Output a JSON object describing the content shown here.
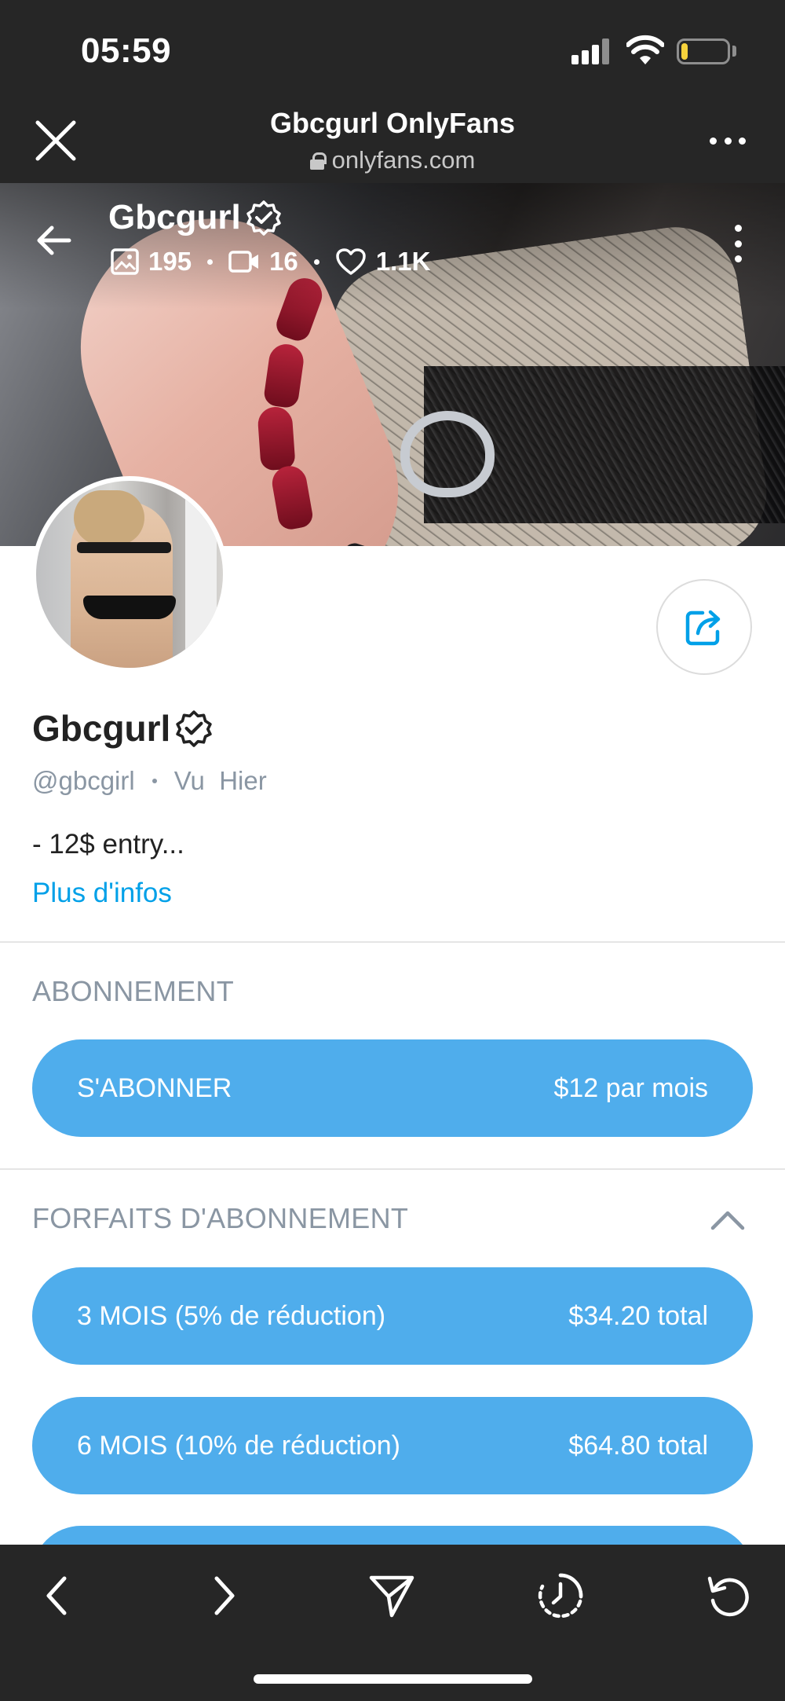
{
  "status_bar": {
    "time": "05:59",
    "battery_level": 0.15,
    "battery_color": "#f7d33c"
  },
  "browser": {
    "title": "Gbcgurl OnlyFans",
    "url": "onlyfans.com"
  },
  "cover": {
    "name": "Gbcgurl",
    "photos_count": "195",
    "videos_count": "16",
    "likes_count": "1.1K"
  },
  "profile": {
    "name": "Gbcgurl",
    "handle": "@gbcgirl",
    "last_seen": "Vu  Hier",
    "bio": "- 12$ entry...",
    "more_info": "Plus d'infos"
  },
  "subscription": {
    "title": "ABONNEMENT",
    "button_label": "S'ABONNER",
    "button_price": "$12 par mois"
  },
  "bundles": {
    "title": "FORFAITS D'ABONNEMENT",
    "items": [
      {
        "label": "3 MOIS (5% de réduction)",
        "price": "$34.20 total"
      },
      {
        "label": "6 MOIS (10% de réduction)",
        "price": "$64.80 total"
      }
    ]
  },
  "colors": {
    "accent": "#00a0e8",
    "button": "#4fadec",
    "muted_text": "#8a96a3",
    "browser_chrome": "#262626"
  },
  "icons": [
    "close-icon",
    "lock-icon",
    "more-icon",
    "back-arrow-icon",
    "verified-icon",
    "image-icon",
    "video-icon",
    "heart-icon",
    "share-icon",
    "chevron-up-icon",
    "chevron-left-icon",
    "chevron-right-icon",
    "send-icon",
    "history-icon",
    "reload-icon"
  ]
}
